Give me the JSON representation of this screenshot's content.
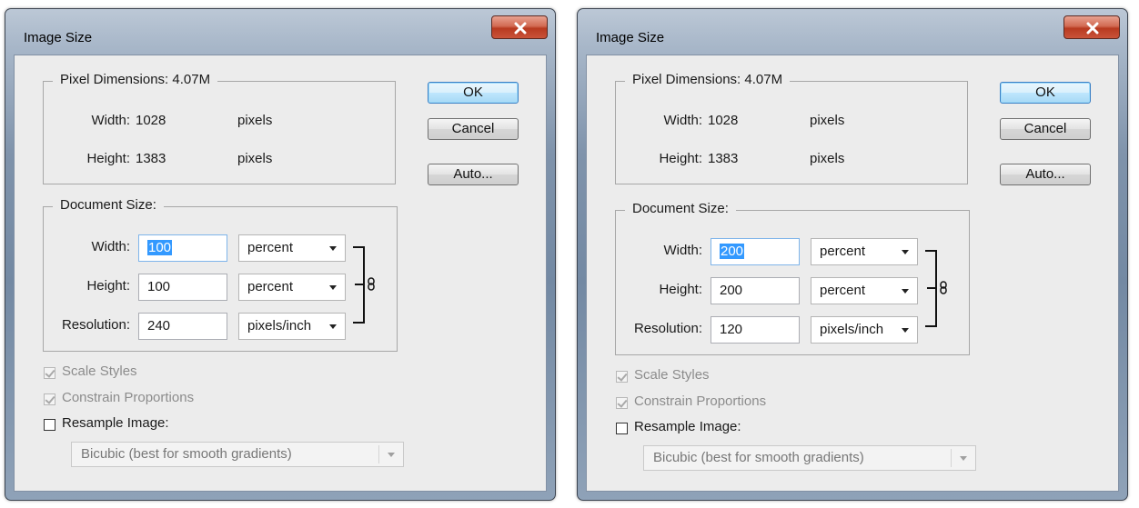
{
  "dialogs": [
    {
      "title": "Image Size",
      "pixel_dimensions": {
        "legend": "Pixel Dimensions:  4.07M",
        "width_label": "Width:",
        "width_value": "1028",
        "width_unit": "pixels",
        "height_label": "Height:",
        "height_value": "1383",
        "height_unit": "pixels"
      },
      "document_size": {
        "legend": "Document Size:",
        "width_label": "Width:",
        "width_value": "100",
        "width_unit": "percent",
        "height_label": "Height:",
        "height_value": "100",
        "height_unit": "percent",
        "resolution_label": "Resolution:",
        "resolution_value": "240",
        "resolution_unit": "pixels/inch"
      },
      "buttons": {
        "ok": "OK",
        "cancel": "Cancel",
        "auto": "Auto..."
      },
      "options": {
        "scale_styles": "Scale Styles",
        "constrain_proportions": "Constrain Proportions",
        "resample_image": "Resample Image:",
        "resample_method": "Bicubic (best for smooth gradients)"
      }
    },
    {
      "title": "Image Size",
      "pixel_dimensions": {
        "legend": "Pixel Dimensions:  4.07M",
        "width_label": "Width:",
        "width_value": "1028",
        "width_unit": "pixels",
        "height_label": "Height:",
        "height_value": "1383",
        "height_unit": "pixels"
      },
      "document_size": {
        "legend": "Document Size:",
        "width_label": "Width:",
        "width_value": "200",
        "width_unit": "percent",
        "height_label": "Height:",
        "height_value": "200",
        "height_unit": "percent",
        "resolution_label": "Resolution:",
        "resolution_value": "120",
        "resolution_unit": "pixels/inch"
      },
      "buttons": {
        "ok": "OK",
        "cancel": "Cancel",
        "auto": "Auto..."
      },
      "options": {
        "scale_styles": "Scale Styles",
        "constrain_proportions": "Constrain Proportions",
        "resample_image": "Resample Image:",
        "resample_method": "Bicubic (best for smooth gradients)"
      }
    }
  ],
  "icons": {
    "close": "close-x-icon",
    "link": "chain-link-icon",
    "dropdown": "chevron-down-icon",
    "check": "checkmark-icon"
  },
  "colors": {
    "selection": "#3399ff",
    "close_button": "#c9533a",
    "dialog_bg": "#ececec",
    "default_button_border": "#3a7fc4"
  }
}
